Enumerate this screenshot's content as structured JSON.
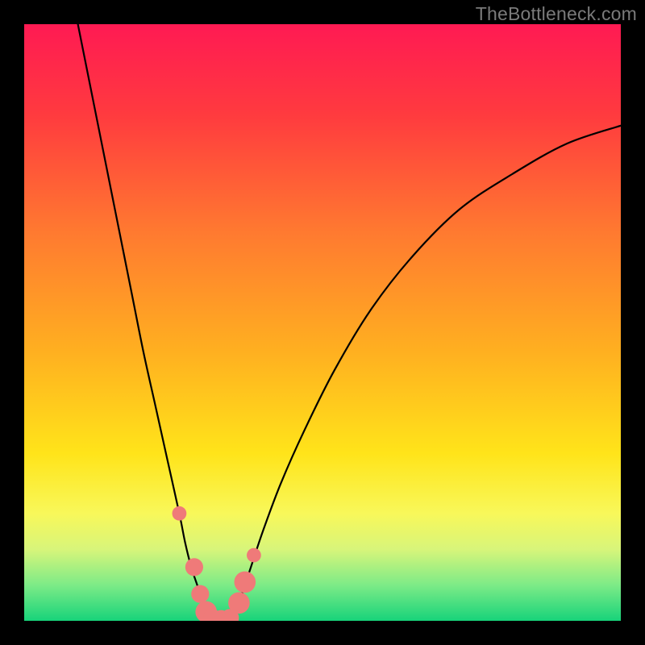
{
  "watermark": "TheBottleneck.com",
  "chart_data": {
    "type": "line",
    "title": "",
    "xlabel": "",
    "ylabel": "",
    "xlim": [
      0,
      100
    ],
    "ylim": [
      0,
      100
    ],
    "gradient_stops": [
      {
        "offset": 0,
        "color": "#ff1a53"
      },
      {
        "offset": 0.15,
        "color": "#ff3a3f"
      },
      {
        "offset": 0.35,
        "color": "#ff7a30"
      },
      {
        "offset": 0.55,
        "color": "#ffb020"
      },
      {
        "offset": 0.72,
        "color": "#ffe41a"
      },
      {
        "offset": 0.82,
        "color": "#f8f85a"
      },
      {
        "offset": 0.88,
        "color": "#d8f57a"
      },
      {
        "offset": 0.94,
        "color": "#7deb87"
      },
      {
        "offset": 1.0,
        "color": "#17d37a"
      }
    ],
    "series": [
      {
        "name": "left-branch",
        "x": [
          9,
          12,
          15,
          18,
          20,
          22,
          24,
          26,
          27,
          28,
          29,
          30,
          31
        ],
        "y": [
          100,
          85,
          70,
          55,
          45,
          36,
          27,
          18,
          13,
          9,
          6,
          3,
          0
        ]
      },
      {
        "name": "right-branch",
        "x": [
          35,
          36,
          38,
          40,
          43,
          47,
          52,
          58,
          65,
          73,
          82,
          91,
          100
        ],
        "y": [
          0,
          3,
          9,
          15,
          23,
          32,
          42,
          52,
          61,
          69,
          75,
          80,
          83
        ]
      }
    ],
    "markers": [
      {
        "x": 26.0,
        "y": 18.0,
        "r": 1.2
      },
      {
        "x": 28.5,
        "y": 9.0,
        "r": 1.5
      },
      {
        "x": 29.5,
        "y": 4.5,
        "r": 1.5
      },
      {
        "x": 30.5,
        "y": 1.5,
        "r": 1.8
      },
      {
        "x": 31.5,
        "y": 0.5,
        "r": 1.5
      },
      {
        "x": 33.0,
        "y": 0.3,
        "r": 1.5
      },
      {
        "x": 34.5,
        "y": 0.5,
        "r": 1.5
      },
      {
        "x": 36.0,
        "y": 3.0,
        "r": 1.8
      },
      {
        "x": 37.0,
        "y": 6.5,
        "r": 1.8
      },
      {
        "x": 38.5,
        "y": 11.0,
        "r": 1.2
      }
    ],
    "marker_color": "#ef7a79"
  }
}
